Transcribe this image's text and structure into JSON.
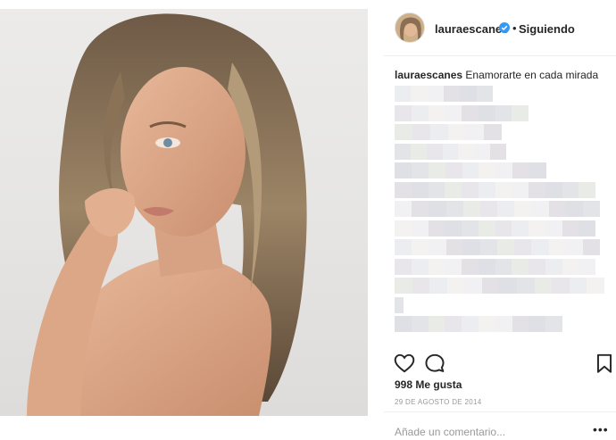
{
  "header": {
    "username": "lauraescanes",
    "separator": "•",
    "follow_status": "Siguiendo",
    "verified_color": "#3897f0"
  },
  "caption": {
    "username": "lauraescanes",
    "text": "Enamorarte en cada mirada"
  },
  "stats": {
    "likes": "998 Me gusta",
    "date": "29 DE AGOSTO DE 2014"
  },
  "comment": {
    "placeholder": "Añade un comentario...",
    "more_label": "•••"
  },
  "icons": {
    "like": "heart-icon",
    "comment": "comment-icon",
    "save": "bookmark-icon",
    "verified": "verified-badge-icon"
  }
}
